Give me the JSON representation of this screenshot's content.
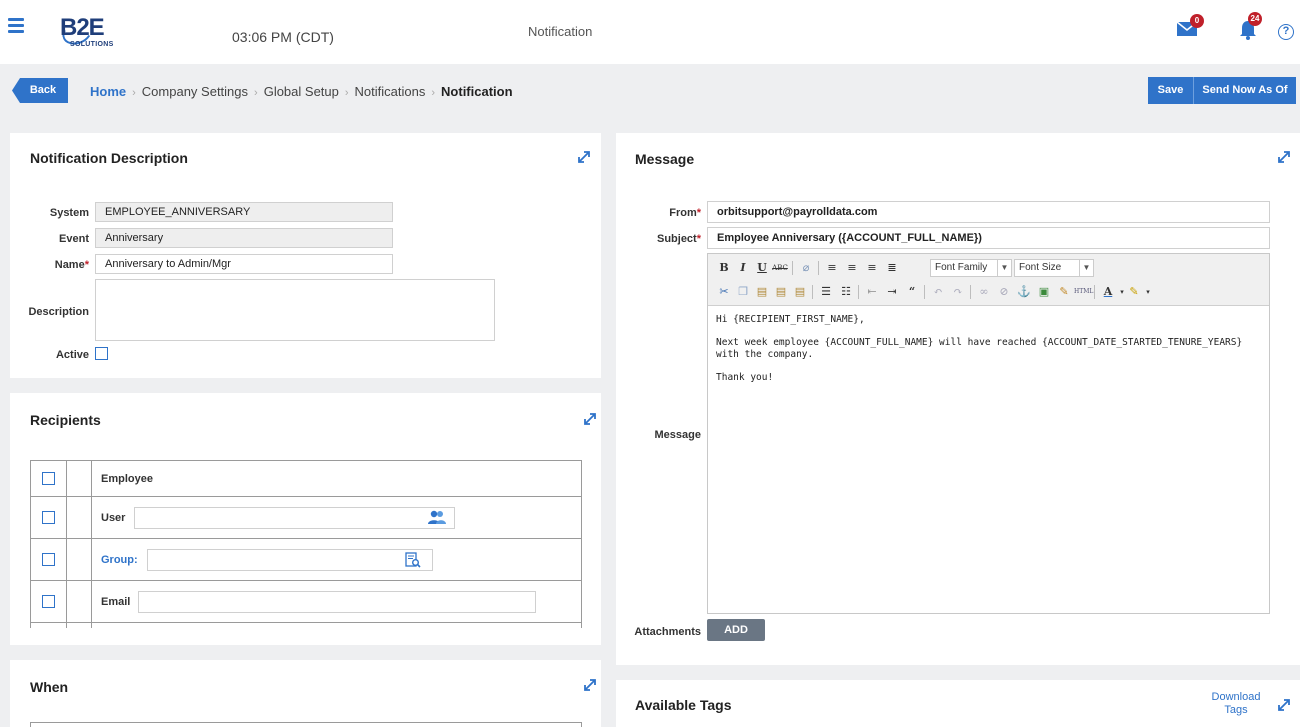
{
  "header": {
    "logo_text_main": "B2E",
    "logo_text_sub": "SOLUTIONS",
    "clock": "03:06 PM (CDT)",
    "page_heading": "Notification",
    "mail_badge": "0",
    "bell_badge": "24",
    "help_label": "?"
  },
  "nav": {
    "back_label": "Back",
    "breadcrumb": [
      "Home",
      "Company Settings",
      "Global Setup",
      "Notifications",
      "Notification"
    ],
    "save_label": "Save",
    "send_now_label": "Send Now As Of"
  },
  "description_panel": {
    "title": "Notification Description",
    "system_label": "System",
    "system_value": "EMPLOYEE_ANNIVERSARY",
    "event_label": "Event",
    "event_value": "Anniversary",
    "name_label": "Name",
    "name_value": "Anniversary to Admin/Mgr",
    "description_label": "Description",
    "description_value": "",
    "active_label": "Active",
    "required_mark": "*"
  },
  "recipients_panel": {
    "title": "Recipients",
    "rows": [
      {
        "label": "Employee"
      },
      {
        "label": "User",
        "value": ""
      },
      {
        "label": "Group:",
        "value": ""
      },
      {
        "label": "Email",
        "value": ""
      }
    ]
  },
  "when_panel": {
    "title": "When"
  },
  "message_panel": {
    "title": "Message",
    "from_label": "From",
    "from_value": "orbitsupport@payrolldata.com",
    "subject_label": "Subject",
    "subject_value": "Employee Anniversary ({ACCOUNT_FULL_NAME})",
    "message_label": "Message",
    "attachments_label": "Attachments",
    "add_label": "ADD",
    "toolbar": {
      "font_family": "Font Family",
      "font_size": "Font Size"
    },
    "body": [
      "Hi {RECIPIENT_FIRST_NAME},",
      "Next week employee {ACCOUNT_FULL_NAME} will have reached {ACCOUNT_DATE_STARTED_TENURE_YEARS} with the company.",
      "Thank you!"
    ]
  },
  "tags_panel": {
    "title": "Available Tags",
    "download_label": "Download Tags"
  },
  "colors": {
    "accent": "#2f73c9",
    "badge": "#c0202a",
    "background": "#eeeff1"
  }
}
